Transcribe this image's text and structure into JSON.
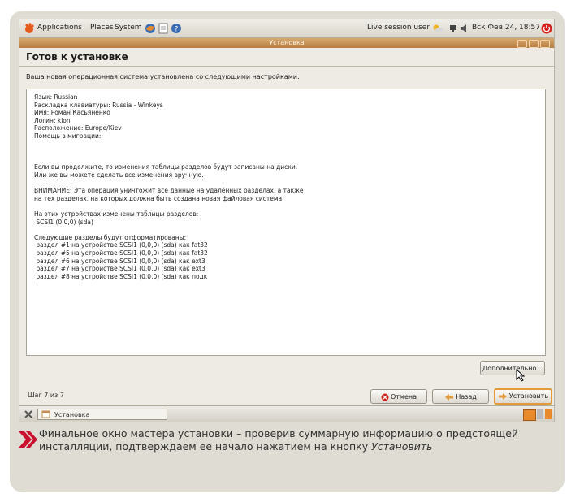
{
  "panel": {
    "menus": [
      "Applications",
      "Places",
      "System"
    ],
    "session_user": "Live session user",
    "clock": "Вск Фев 24, 18:57"
  },
  "window": {
    "title": "Установка",
    "heading": "Готов к установке",
    "intro": "Ваша новая операционная система установлена со следующими настройками:",
    "summary_lines": [
      "Язык: Russian",
      "Раскладка клавиатуры: Russia - Winkeys",
      "Имя: Роман Касьяненко",
      "Логин: kion",
      "Расположение: Europe/Kiev",
      "Помощь в миграции:",
      "",
      "",
      "",
      "Если вы продолжите, то изменения таблицы разделов будут записаны на диски.",
      "Или же вы можете сделать все изменения вручную.",
      "",
      "ВНИМАНИЕ: Эта операция уничтожит все данные на удалённых разделах, а также",
      "на тех разделах, на которых должна быть создана новая файловая система.",
      "",
      "На этих устройствах изменены таблицы разделов:",
      " SCSI1 (0,0,0) (sda)",
      "",
      "Следующие разделы будут отформатированы:",
      " раздел #1 на устройстве SCSI1 (0,0,0) (sda) как fat32",
      " раздел #5 на устройстве SCSI1 (0,0,0) (sda) как fat32",
      " раздел #6 на устройстве SCSI1 (0,0,0) (sda) как ext3",
      " раздел #7 на устройстве SCSI1 (0,0,0) (sda) как ext3",
      " раздел #8 на устройстве SCSI1 (0,0,0) (sda) как подк"
    ],
    "advanced_label": "Дополнительно...",
    "step_label": "Шаг 7 из 7",
    "cancel_label": "Отмена",
    "back_label": "Назад",
    "install_label": "Установить"
  },
  "taskbar": {
    "task_label": "Установка"
  },
  "caption": {
    "text": "Финальное окно мастера установки – проверив суммарную информацию о предстоящей инсталляции, подтверждаем ее начало нажатием на кнопку",
    "italic_word": "Установить"
  },
  "colors": {
    "accent": "#c8102e",
    "titlebar": "#c68d52",
    "frame": "#dfdcd4"
  }
}
